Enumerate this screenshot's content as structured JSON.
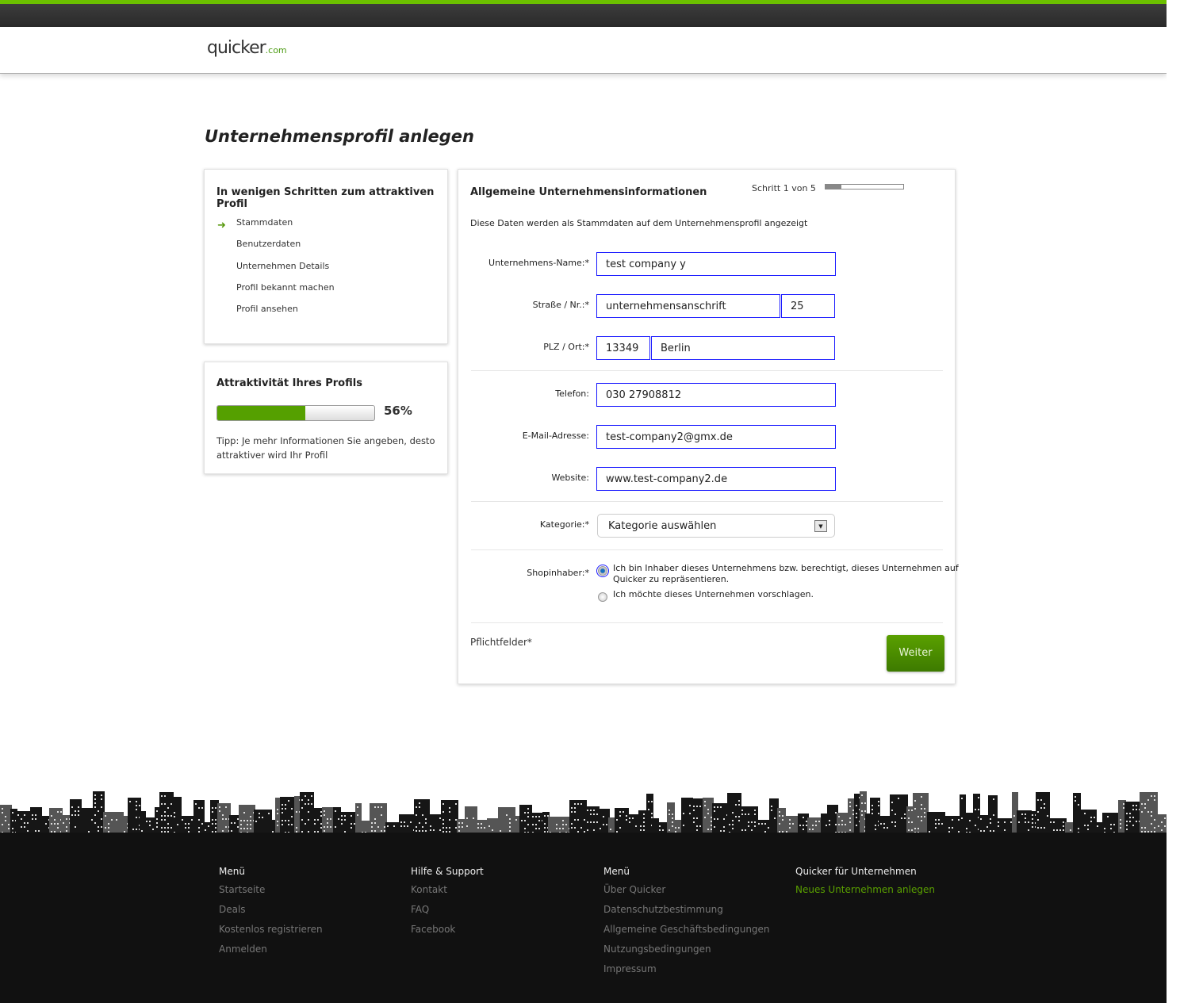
{
  "logo": {
    "main": "quicker",
    "suffix": ".com"
  },
  "page_title": "Unternehmensprofil anlegen",
  "steps_box": {
    "title": "In wenigen Schritten zum attraktiven Profil",
    "items": [
      "Stammdaten",
      "Benutzerdaten",
      "Unternehmen Details",
      "Profil bekannt machen",
      "Profil ansehen"
    ],
    "current": 0
  },
  "attractiveness": {
    "title": "Attraktivität Ihres Profils",
    "percent_label": "56%",
    "percent": 56,
    "tip": "Tipp: Je mehr Informationen Sie angeben, desto attraktiver wird Ihr Profil"
  },
  "form": {
    "title": "Allgemeine Unternehmensinformationen",
    "step_label": "Schritt 1 von 5",
    "step_fraction": 0.2,
    "subtitle": "Diese Daten werden als Stammdaten auf dem Unternehmensprofil angezeigt",
    "labels": {
      "name": "Unternehmens-Name:*",
      "street": "Straße / Nr.:*",
      "zip": "PLZ / Ort:*",
      "phone": "Telefon:",
      "email": "E-Mail-Adresse:",
      "website": "Website:",
      "category": "Kategorie:*",
      "owner": "Shopinhaber:*"
    },
    "values": {
      "name": "test company y",
      "street": "unternehmensanschrift",
      "number": "25",
      "zip": "13349",
      "city": "Berlin",
      "phone": "030 27908812",
      "email": "test-company2@gmx.de",
      "website": "www.test-company2.de",
      "category": "Kategorie auswählen"
    },
    "radio_options": [
      "Ich bin Inhaber dieses Unternehmens bzw. berechtigt, dieses Unternehmen auf Quicker zu repräsentieren.",
      "Ich möchte dieses Unternehmen vorschlagen."
    ],
    "required_note": "Pflichtfelder*",
    "next_button": "Weiter"
  },
  "footer": {
    "columns": [
      {
        "title": "Menü",
        "links": [
          "Startseite",
          "Deals",
          "Kostenlos registrieren",
          "Anmelden"
        ]
      },
      {
        "title": "Hilfe & Support",
        "links": [
          "Kontakt",
          "FAQ",
          "Facebook"
        ]
      },
      {
        "title": "Menü",
        "links": [
          "Über Quicker",
          "Datenschutzbestimmung",
          "Allgemeine Geschäftsbedingungen",
          "Nutzungsbedingungen",
          "Impressum"
        ]
      },
      {
        "title": "Quicker für Unternehmen",
        "links": [
          "Neues Unternehmen anlegen"
        ]
      }
    ]
  }
}
